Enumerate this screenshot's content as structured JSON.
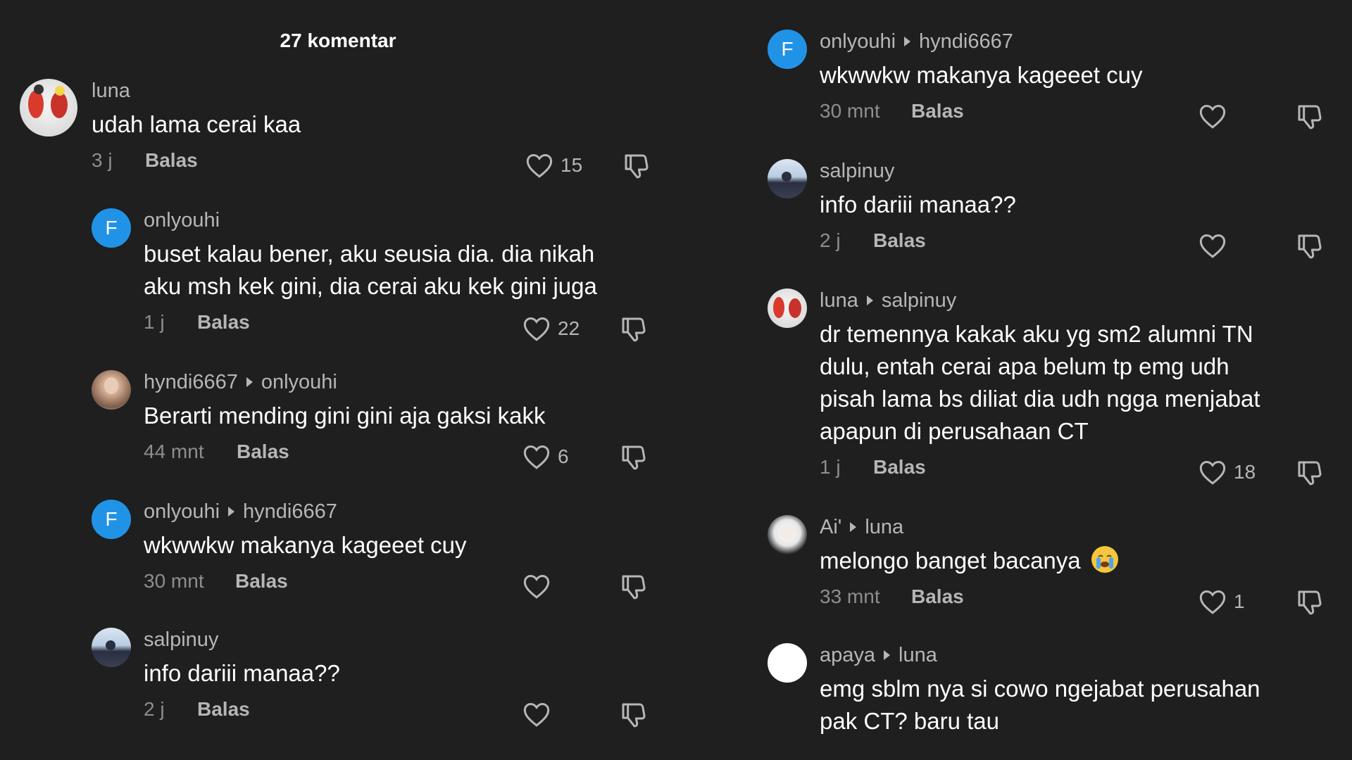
{
  "header": {
    "title": "27 komentar"
  },
  "reply_label": "Balas",
  "comments_left": [
    {
      "user": "luna",
      "reply_to": "",
      "text": "udah lama cerai kaa",
      "time": "3 j",
      "likes": "15",
      "avatar": "photo-luna"
    },
    {
      "user": "onlyouhi",
      "reply_to": "",
      "text": "buset kalau bener, aku seusia dia. dia nikah\naku msh kek gini, dia cerai aku kek gini juga",
      "time": "1 j",
      "likes": "22",
      "avatar": "F"
    },
    {
      "user": "hyndi6667",
      "reply_to": "onlyouhi",
      "text": "Berarti mending gini gini aja gaksi kakk",
      "time": "44 mnt",
      "likes": "6",
      "avatar": "photo-hyndi"
    },
    {
      "user": "onlyouhi",
      "reply_to": "hyndi6667",
      "text": "wkwwkw makanya kageeet cuy",
      "time": "30 mnt",
      "likes": "",
      "avatar": "F"
    },
    {
      "user": "salpinuy",
      "reply_to": "",
      "text": "info dariii manaa??",
      "time": "2 j",
      "likes": "",
      "avatar": "photo-salp"
    }
  ],
  "comments_right": [
    {
      "user": "onlyouhi",
      "reply_to": "hyndi6667",
      "text": "wkwwkw makanya kageeet cuy",
      "time": "30 mnt",
      "likes": "",
      "avatar": "F"
    },
    {
      "user": "salpinuy",
      "reply_to": "",
      "text": "info dariii manaa??",
      "time": "2 j",
      "likes": "",
      "avatar": "photo-salp"
    },
    {
      "user": "luna",
      "reply_to": "salpinuy",
      "text": "dr temennya kakak aku yg sm2 alumni TN\ndulu, entah cerai apa belum tp emg udh\npisah lama bs diliat dia udh ngga menjabat\napapun di perusahaan CT",
      "time": "1 j",
      "likes": "18",
      "avatar": "photo-luna"
    },
    {
      "user": "Ai'",
      "reply_to": "luna",
      "text": "melongo banget bacanya",
      "time": "33 mnt",
      "likes": "1",
      "avatar": "photo-ai",
      "emoji": "loudly-crying-face-emoji"
    },
    {
      "user": "apaya",
      "reply_to": "luna",
      "text": "emg sblm nya si cowo ngejabat perusahan\npak CT? baru tau",
      "time": "",
      "likes": "",
      "avatar": "white"
    }
  ],
  "icons": {
    "like": "heart-outline-icon",
    "dislike": "thumbs-down-icon",
    "emoji": "loudly-crying-face-emoji"
  },
  "colors": {
    "background": "#1f1f1f",
    "avatar_letter_bg": "#2193e6",
    "text": "#ffffff",
    "muted": "#8e8e8e"
  }
}
